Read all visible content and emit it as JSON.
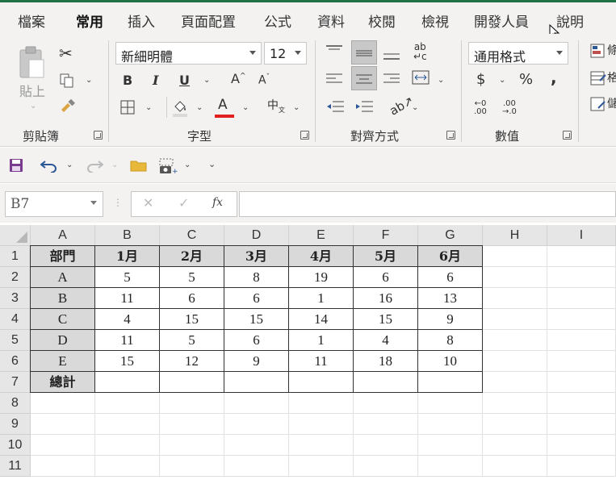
{
  "tabs": [
    "檔案",
    "常用",
    "插入",
    "頁面配置",
    "公式",
    "資料",
    "校閱",
    "檢視",
    "開發人員",
    "說明"
  ],
  "active_tab": "常用",
  "ribbon": {
    "clipboard": {
      "paste_label": "貼上",
      "group_label": "剪貼簿"
    },
    "font": {
      "font_name": "新細明體",
      "font_size": "12",
      "group_label": "字型",
      "bold": "B",
      "italic": "I",
      "underline": "U",
      "font_color_glyph": "A",
      "font_color": "#e0201e",
      "phonetic_glyph": "中"
    },
    "alignment": {
      "group_label": "對齊方式"
    },
    "number": {
      "format": "通用格式",
      "group_label": "數值",
      "currency": "$",
      "percent": "%",
      "comma": ","
    }
  },
  "formula_bar": {
    "name_box": "B7",
    "fx": "fx",
    "formula": ""
  },
  "grid": {
    "columns": [
      "A",
      "B",
      "C",
      "D",
      "E",
      "F",
      "G",
      "H",
      "I"
    ],
    "rows": [
      "1",
      "2",
      "3",
      "4",
      "5",
      "6",
      "7",
      "8",
      "9",
      "10",
      "11"
    ],
    "table": [
      [
        "部門",
        "1月",
        "2月",
        "3月",
        "4月",
        "5月",
        "6月"
      ],
      [
        "A",
        "5",
        "5",
        "8",
        "19",
        "6",
        "6"
      ],
      [
        "B",
        "11",
        "6",
        "6",
        "1",
        "16",
        "13"
      ],
      [
        "C",
        "4",
        "15",
        "15",
        "14",
        "15",
        "9"
      ],
      [
        "D",
        "11",
        "5",
        "6",
        "1",
        "4",
        "8"
      ],
      [
        "E",
        "15",
        "12",
        "9",
        "11",
        "18",
        "10"
      ],
      [
        "總計",
        "",
        "",
        "",
        "",
        "",
        ""
      ]
    ]
  },
  "colors": {
    "accent": "#217346",
    "header_fill": "#d9d9d9",
    "save_icon": "#7a3b8f",
    "undo_icon": "#2b5797"
  }
}
